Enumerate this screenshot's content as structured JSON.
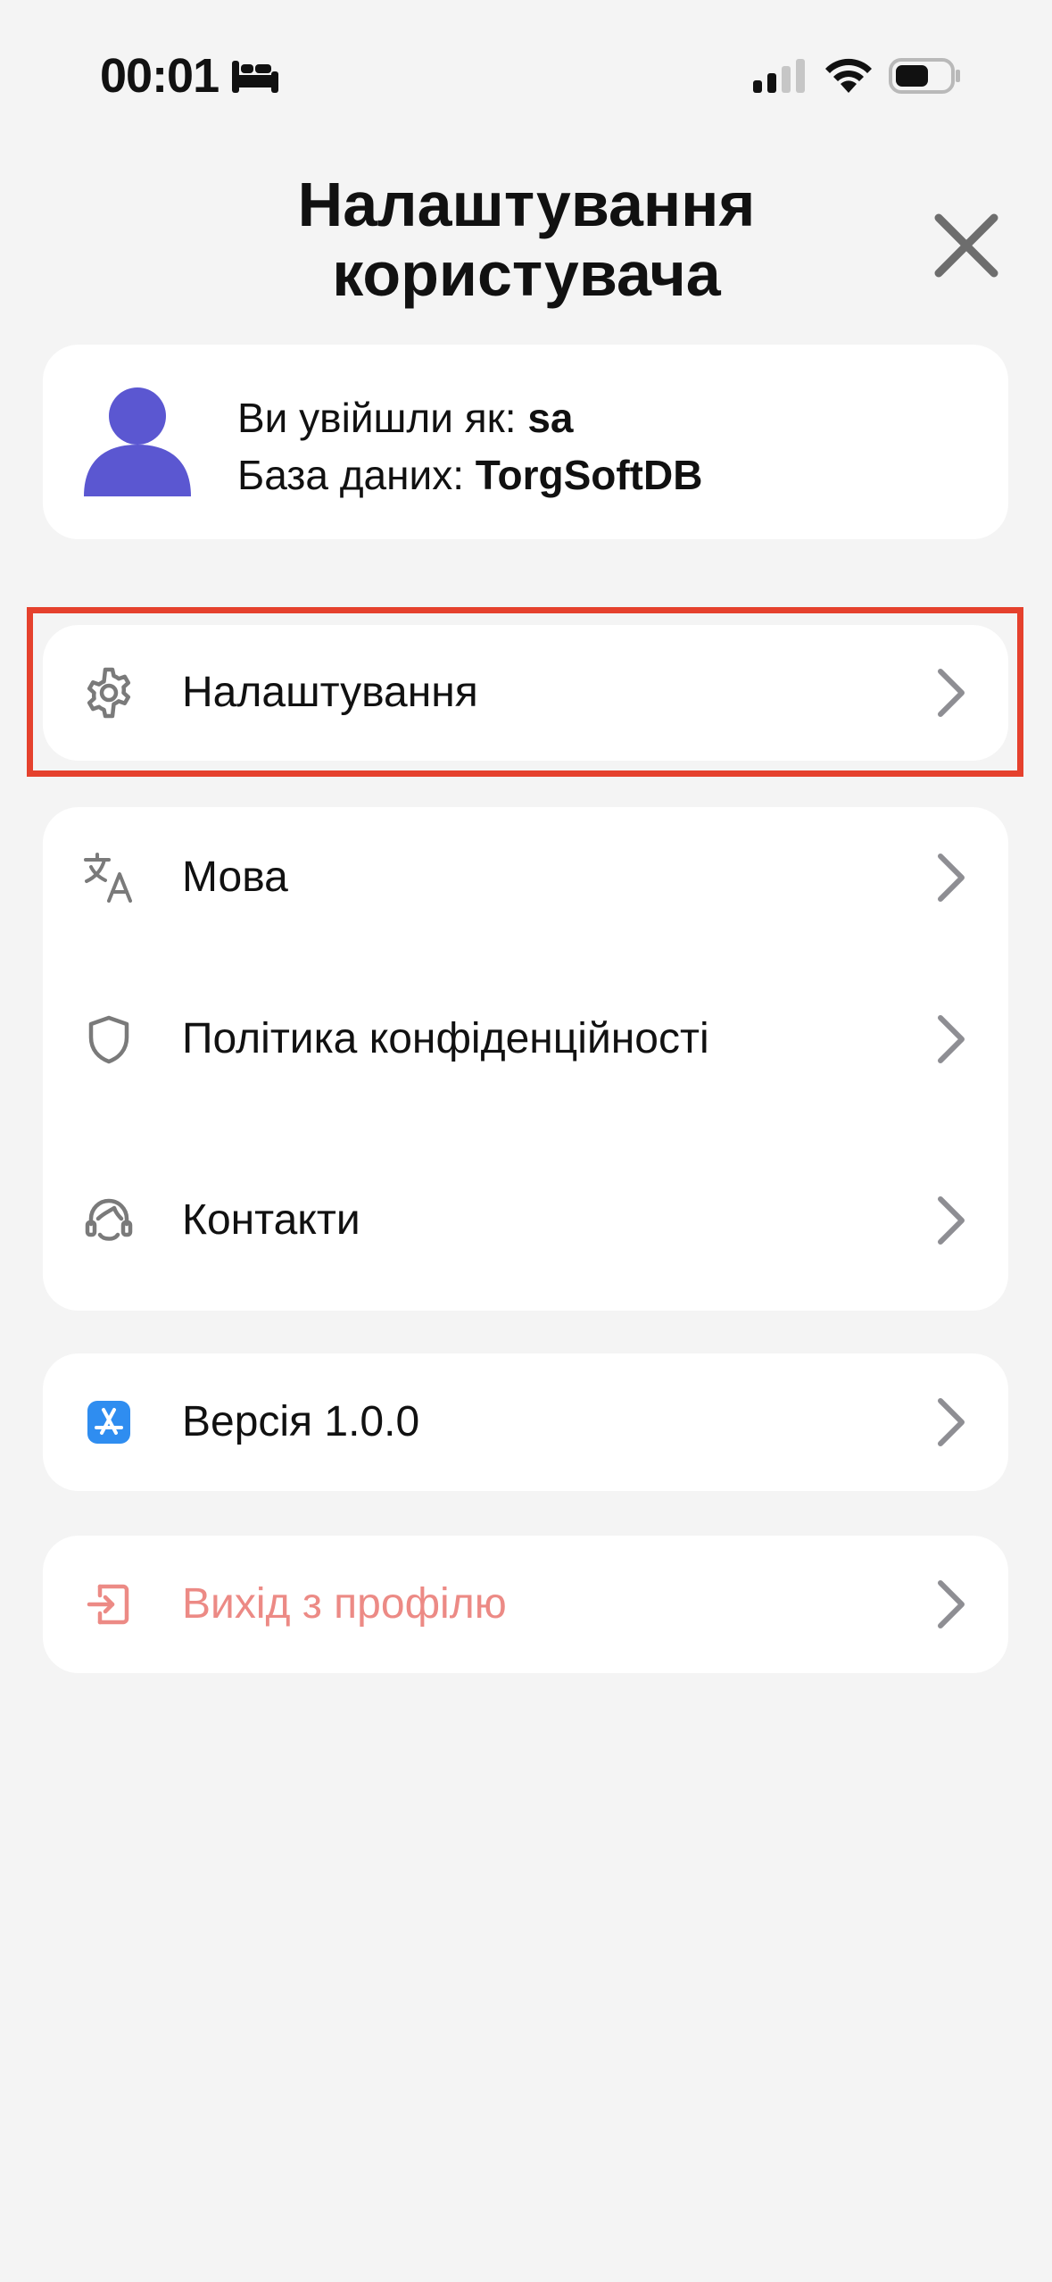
{
  "status_bar": {
    "time": "00:01",
    "focus_icon": "bed-icon",
    "signal_icon": "cellular-signal-icon",
    "wifi_icon": "wifi-icon",
    "battery_icon": "battery-icon"
  },
  "header": {
    "title_line1": "Налаштування",
    "title_line2": "користувача",
    "close_icon": "close-icon"
  },
  "user_card": {
    "logged_in_label": "Ви увійшли як: ",
    "logged_in_value": "sa",
    "database_label": "База даних: ",
    "database_value": "TorgSoftDB",
    "avatar_color": "#5b57d1"
  },
  "menu": {
    "settings": {
      "label": "Налаштування",
      "icon": "gear-icon"
    },
    "language": {
      "label": "Мова",
      "icon": "translate-icon"
    },
    "privacy": {
      "label": "Політика конфіденційності",
      "icon": "shield-icon"
    },
    "contacts": {
      "label": "Контакти",
      "icon": "headset-icon"
    },
    "version": {
      "label": "Версія 1.0.0",
      "icon": "app-store-icon"
    },
    "logout": {
      "label": "Вихід з профілю",
      "icon": "logout-icon"
    }
  },
  "colors": {
    "background": "#f4f4f4",
    "card": "#ffffff",
    "accent": "#5b57d1",
    "highlight": "#e5412d",
    "logout_text": "#ec8a85",
    "chevron": "#8e8e93"
  }
}
